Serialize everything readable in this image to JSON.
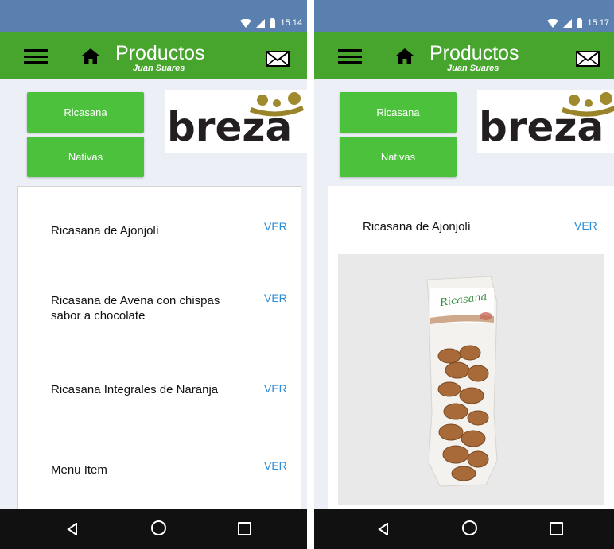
{
  "screens": [
    {
      "status_time": "15:14",
      "app_title": "Productos",
      "app_subtitle": "Juan Suares",
      "categories": [
        "Ricasana",
        "Nativas"
      ],
      "brand": "breza",
      "items": [
        {
          "name": "Ricasana de Ajonjolí",
          "action": "VER"
        },
        {
          "name": "Ricasana de Avena con chispas sabor a chocolate",
          "action": "VER"
        },
        {
          "name": "Ricasana Integrales de Naranja",
          "action": "VER"
        },
        {
          "name": "Menu Item",
          "action": "VER"
        }
      ]
    },
    {
      "status_time": "15:17",
      "app_title": "Productos",
      "app_subtitle": "Juan Suares",
      "categories": [
        "Ricasana",
        "Nativas"
      ],
      "brand": "breza",
      "selected_item": {
        "name": "Ricasana de Ajonjolí",
        "action": "VER"
      },
      "package_label": "Ricasana"
    }
  ],
  "colors": {
    "appbar": "#47a52e",
    "button": "#4cc13c",
    "link": "#2a8bd6",
    "statusbar": "#5a80b0"
  }
}
